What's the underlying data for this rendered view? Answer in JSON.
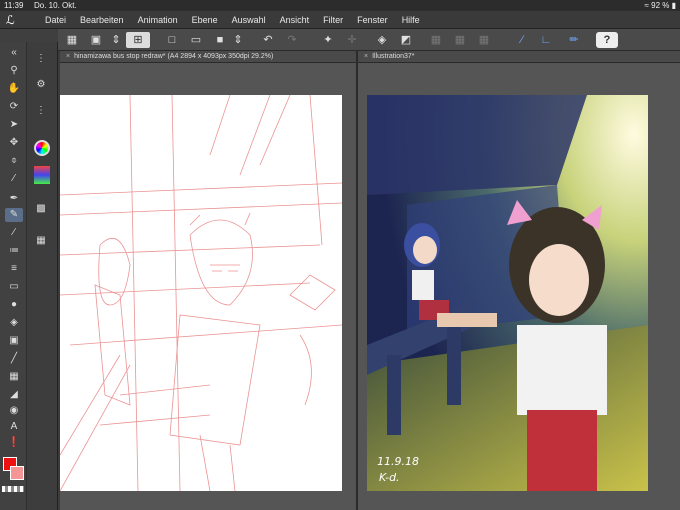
{
  "status": {
    "time": "11:39",
    "date": "Do. 10. Okt.",
    "battery": "92 %"
  },
  "menu": {
    "items": [
      "Datei",
      "Bearbeiten",
      "Animation",
      "Ebene",
      "Auswahl",
      "Ansicht",
      "Filter",
      "Fenster",
      "Hilfe"
    ]
  },
  "toolbar": {
    "help_label": "?"
  },
  "tabs": {
    "left": "hinamizawa bus stop redraw* (A4 2894 x 4093px 350dpi 29.2%)",
    "right": "Illustration37*"
  },
  "signature": {
    "line1": "11.9.18",
    "line2": "K-d."
  },
  "colors": {
    "foreground": "#e11111",
    "background": "#f59595",
    "accent": "#6fa8ff"
  }
}
